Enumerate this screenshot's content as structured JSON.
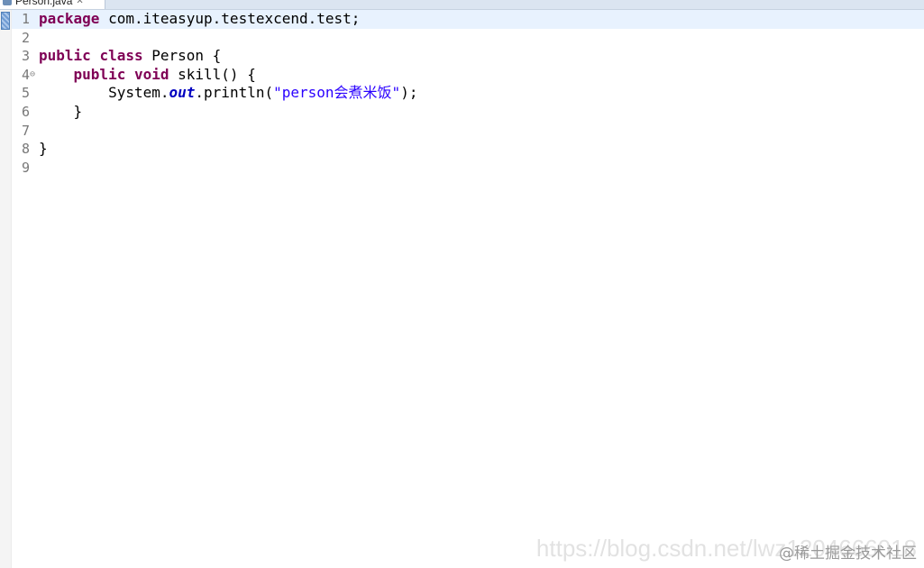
{
  "tab": {
    "title": "Person.java",
    "close_glyph": "✕"
  },
  "editor": {
    "lines": [
      {
        "num": "1",
        "fold": "",
        "tokens": [
          {
            "t": "package",
            "c": "kw"
          },
          {
            "t": " com.iteasyup.testexcend.test;",
            "c": ""
          }
        ]
      },
      {
        "num": "2",
        "fold": "",
        "tokens": []
      },
      {
        "num": "3",
        "fold": "",
        "tokens": [
          {
            "t": "public",
            "c": "kw"
          },
          {
            "t": " ",
            "c": ""
          },
          {
            "t": "class",
            "c": "kw"
          },
          {
            "t": " Person {",
            "c": ""
          }
        ]
      },
      {
        "num": "4",
        "fold": "⊖",
        "tokens": [
          {
            "t": "    ",
            "c": ""
          },
          {
            "t": "public",
            "c": "kw"
          },
          {
            "t": " ",
            "c": ""
          },
          {
            "t": "void",
            "c": "kw"
          },
          {
            "t": " skill() {",
            "c": ""
          }
        ]
      },
      {
        "num": "5",
        "fold": "",
        "tokens": [
          {
            "t": "        System.",
            "c": ""
          },
          {
            "t": "out",
            "c": "field"
          },
          {
            "t": ".println(",
            "c": ""
          },
          {
            "t": "\"person会煮米饭\"",
            "c": "str"
          },
          {
            "t": ");",
            "c": ""
          }
        ]
      },
      {
        "num": "6",
        "fold": "",
        "tokens": [
          {
            "t": "    }",
            "c": ""
          }
        ]
      },
      {
        "num": "7",
        "fold": "",
        "tokens": []
      },
      {
        "num": "8",
        "fold": "",
        "tokens": [
          {
            "t": "}",
            "c": ""
          }
        ]
      },
      {
        "num": "9",
        "fold": "",
        "tokens": []
      }
    ]
  },
  "watermark": {
    "url_text": "https://blog.csdn.net/lwz1204666018",
    "tag_text": "@稀土掘金技术社区"
  },
  "colors": {
    "keyword": "#7f0055",
    "field": "#0000c0",
    "string": "#2a00ff",
    "current_line": "#e8f2fe"
  }
}
